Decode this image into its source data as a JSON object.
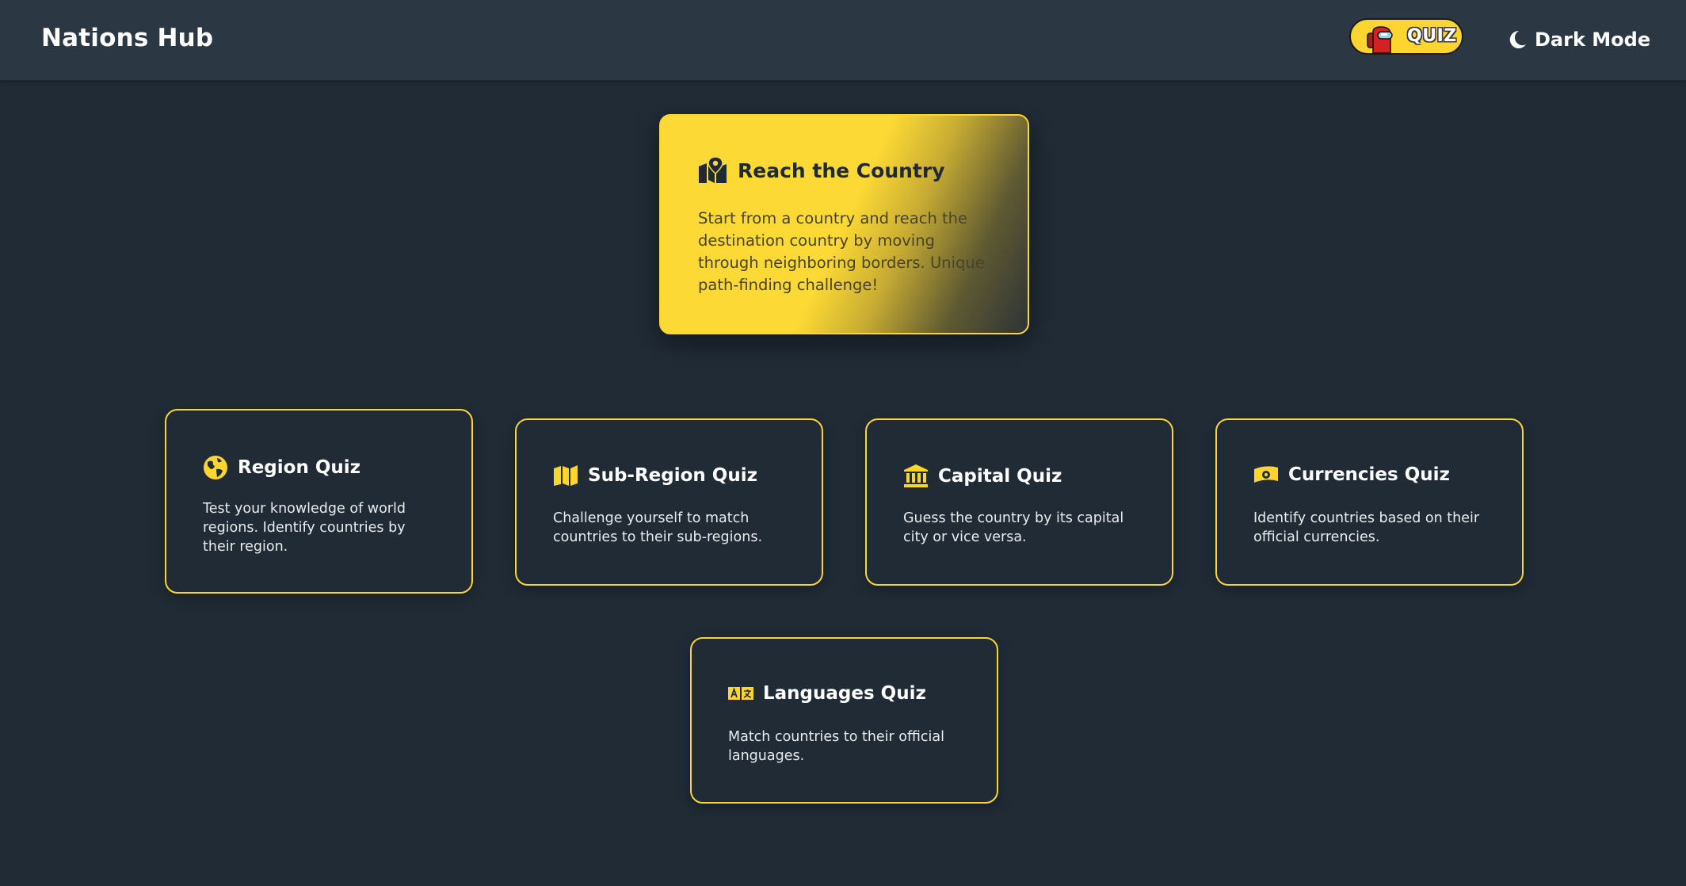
{
  "header": {
    "brand": "Nations Hub",
    "quiz_pill_label": "QUIZ",
    "mode_toggle_label": "Dark Mode",
    "mode_icon": "moon-icon"
  },
  "featured": {
    "title": "Reach the Country",
    "description": "Start from a country and reach the destination country by moving through neighboring borders. Unique path-finding challenge!",
    "icon": "map-pin-icon"
  },
  "quizzes": [
    {
      "title": "Region Quiz",
      "description": "Test your knowledge of world regions. Identify countries by their region.",
      "icon": "globe-icon"
    },
    {
      "title": "Sub-Region Quiz",
      "description": "Challenge yourself to match countries to their sub-regions.",
      "icon": "map-icon"
    },
    {
      "title": "Capital Quiz",
      "description": "Guess the country by its capital city or vice versa.",
      "icon": "landmark-icon"
    },
    {
      "title": "Currencies Quiz",
      "description": "Identify countries based on their official currencies.",
      "icon": "money-bill-icon"
    },
    {
      "title": "Languages Quiz",
      "description": "Match countries to their official languages.",
      "icon": "language-icon"
    }
  ],
  "colors": {
    "background": "#202b36",
    "header": "#2b3743",
    "accent": "#fcd62f",
    "text": "#ffffff"
  }
}
